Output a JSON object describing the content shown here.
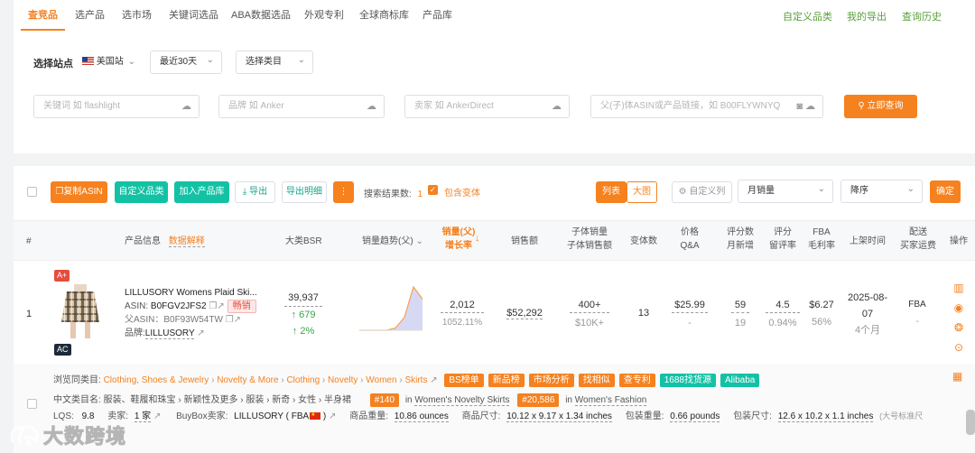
{
  "nav": {
    "tabs": [
      "查竞品",
      "选产品",
      "选市场",
      "关键词选品",
      "ABA数据选品",
      "外观专利",
      "全球商标库",
      "产品库"
    ],
    "right_links": [
      "自定义品类",
      "我的导出",
      "查询历史"
    ]
  },
  "search": {
    "station_label": "选择站点",
    "station_value": "美国站",
    "period_value": "最近30天",
    "category_value": "选择类目",
    "keyword_placeholder": "关键词 如 flashlight",
    "brand_placeholder": "品牌 如 Anker",
    "seller_placeholder": "卖家 如 AnkerDirect",
    "asin_placeholder": "父(子)体ASIN或产品链接，如 B00FLYWNYQ",
    "query_button": "立即查询"
  },
  "toolbar": {
    "copy_asin": "复制ASIN",
    "custom_category": "自定义品类",
    "add_library": "加入产品库",
    "export": "导出",
    "export_detail": "导出明细",
    "result_count_label": "搜索结果数:",
    "result_count": "1",
    "include_variants": "包含变体",
    "view_list": "列表",
    "view_grid": "大图",
    "custom_columns": "自定义列",
    "sort_field": "月销量",
    "sort_order": "降序",
    "confirm": "确定"
  },
  "headers": {
    "index": "#",
    "product_info": "产品信息",
    "data_explain": "数据解释",
    "bsr": "大类BSR",
    "sales_trend": "销量趋势(父)",
    "sales_l1": "销量(父)",
    "sales_l2": "增长率",
    "revenue": "销售额",
    "child_l1": "子体销量",
    "child_l2": "子体销售额",
    "variants": "变体数",
    "price_l1": "价格",
    "price_l2": "Q&A",
    "rating_l1": "评分数",
    "rating_l2": "月新增",
    "score_l1": "评分",
    "score_l2": "留评率",
    "fba_l1": "FBA",
    "fba_l2": "毛利率",
    "listed": "上架时间",
    "ship_l1": "配送",
    "ship_l2": "买家运费",
    "action": "操作"
  },
  "row": {
    "index": "1",
    "badge_top": "A+",
    "badge_bottom": "AC",
    "title": "LILLUSORY Womens Plaid Ski...",
    "asin_label": "ASIN:",
    "asin": "B0FGV2JFS2",
    "hot_tag": "畅销",
    "parent_asin_label": "父ASIN：",
    "parent_asin": "B0F93W54TW",
    "brand_label": "品牌:",
    "brand": "LILLUSORY",
    "bsr": "39,937",
    "bsr_change": "↑ 679",
    "bsr_pct": "↑ 2%",
    "sales": "2,012",
    "growth": "1052.11%",
    "revenue": "$52,292",
    "child_sales": "400+",
    "child_revenue": "$10K+",
    "variants": "13",
    "price": "$25.99",
    "qa": "-",
    "ratings": "59",
    "ratings_new": "19",
    "score": "4.5",
    "review_rate": "0.94%",
    "fba": "$6.27",
    "margin": "56%",
    "listed_date_l1": "2025-08-",
    "listed_date_l2": "07",
    "listed_age": "4个月",
    "shipping": "FBA",
    "buyer_fee": "-"
  },
  "trend_chart": {
    "type": "area",
    "values": [
      0,
      0,
      0,
      0,
      0.05,
      0.3,
      1.0,
      0.72
    ],
    "color": "#8b8fe0"
  },
  "detail": {
    "category_label": "浏览同类目:",
    "category_path": [
      "Clothing, Shoes & Jewelry",
      "Novelty & More",
      "Clothing",
      "Novelty",
      "Women",
      "Skirts"
    ],
    "tags": [
      "BS榜单",
      "新品榜",
      "市场分析",
      "找相似",
      "查专利",
      "1688找货源",
      "Alibaba"
    ],
    "cn_category": "中文类目名: 服装、鞋履和珠宝 › 新颖性及更多 › 服装 › 新奇 › 女性 › 半身裙",
    "rank1": "#140",
    "rank1_in": "in",
    "rank1_cat": "Women's Novelty Skirts",
    "rank2": "#20,586",
    "rank2_in": "in",
    "rank2_cat": "Women's Fashion",
    "lqs_label": "LQS:",
    "lqs": "9.8",
    "sellers_label": "卖家:",
    "sellers": "1 家",
    "buybox_label": "BuyBox卖家:",
    "buybox": "LILLUSORY ( FBA",
    "weight_label": "商品重量:",
    "weight": "10.86 ounces",
    "size_label": "商品尺寸:",
    "size": "10.12 x 9.17 x 1.34 inches",
    "pkg_weight_label": "包装重量:",
    "pkg_weight": "0.66 pounds",
    "pkg_size_label": "包装尺寸:",
    "pkg_size": "12.6 x 10.2 x 1.1 inches",
    "pkg_note": "(大号标准尺"
  },
  "watermark": "大数跨境",
  "colors": {
    "accent": "#f5811f",
    "teal": "#13c2a5",
    "green": "#5aa03c"
  }
}
